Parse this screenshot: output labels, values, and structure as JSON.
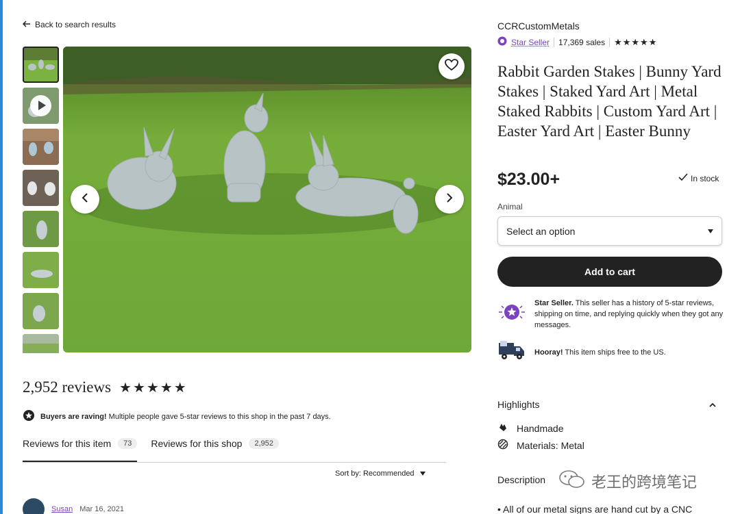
{
  "nav": {
    "back_label": "Back to search results"
  },
  "shop": {
    "name": "CCRCustomMetals",
    "star_seller_label": "Star Seller",
    "sales": "17,369 sales",
    "rating_stars": "★★★★★"
  },
  "listing": {
    "title": "Rabbit Garden Stakes | Bunny Yard Stakes | Staked Yard Art | Metal Staked Rabbits | Custom Yard Art | Easter Yard Art | Easter Bunny",
    "price": "$23.00+",
    "stock": "In stock",
    "option_label": "Animal",
    "select_placeholder": "Select an option",
    "add_to_cart": "Add to cart"
  },
  "star_seller_info": {
    "bold": "Star Seller.",
    "text": " This seller has a history of 5-star reviews, shipping on time, and replying quickly when they got any messages."
  },
  "shipping_info": {
    "bold": "Hooray!",
    "text": " This item ships free to the US."
  },
  "highlights": {
    "title": "Highlights",
    "items": [
      {
        "label": "Handmade",
        "icon": "hand-icon"
      },
      {
        "label": "Materials: Metal",
        "icon": "materials-icon"
      }
    ]
  },
  "description": {
    "title": "Description",
    "first_line": "• All of our metal signs are hand cut by a CNC"
  },
  "watermark": {
    "text": "老王的跨境笔记"
  },
  "reviews": {
    "count_label": "2,952 reviews",
    "stars": "★★★★★",
    "raving_bold": "Buyers are raving!",
    "raving_text": " Multiple people gave 5-star reviews to this shop in the past 7 days.",
    "tabs": [
      {
        "label": "Reviews for this item",
        "count": "73"
      },
      {
        "label": "Reviews for this shop",
        "count": "2,952"
      }
    ],
    "sort_label": "Sort by: Recommended",
    "first_review": {
      "user": "Susan",
      "date": "Mar 16, 2021"
    }
  },
  "colors": {
    "accent_purple": "#7b43bd",
    "button_dark": "#222222",
    "grass": "#6fa83a"
  }
}
